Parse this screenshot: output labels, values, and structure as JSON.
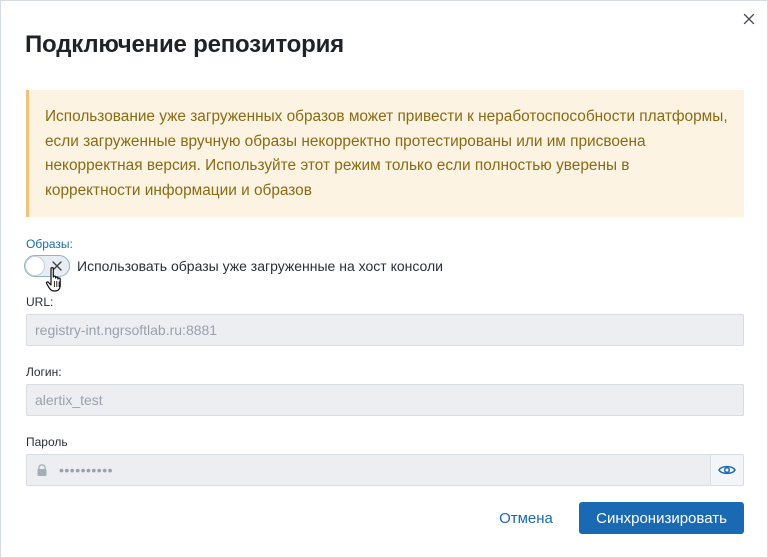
{
  "dialog": {
    "title": "Подключение репозитория",
    "close_icon": "close-icon"
  },
  "warning": {
    "text": "Использование уже загруженных образов может привести к неработоспособности платформы, если загруженные вручную образы некорректно протестированы или им присвоена некорректная версия. Используйте этот режим только если полностью уверены в корректности информации и образов"
  },
  "images": {
    "section_label": "Образы:",
    "toggle_label": "Использовать образы уже загруженные на хост консоли",
    "toggle_on": false
  },
  "url": {
    "label": "URL:",
    "value": "registry-int.ngrsoftlab.ru:8881"
  },
  "login": {
    "label": "Логин:",
    "value": "alertix_test"
  },
  "password": {
    "label": "Пароль",
    "masked_value": "••••••••••",
    "lock_icon": "lock-icon",
    "toggle_icon": "eye-icon"
  },
  "footer": {
    "cancel_label": "Отмена",
    "submit_label": "Синхронизировать"
  },
  "colors": {
    "accent": "#1a6ab3",
    "warning_bg": "#fdf3e3",
    "warning_border": "#f2c27a",
    "warning_text": "#8a6a12",
    "field_bg": "#eceef2"
  }
}
